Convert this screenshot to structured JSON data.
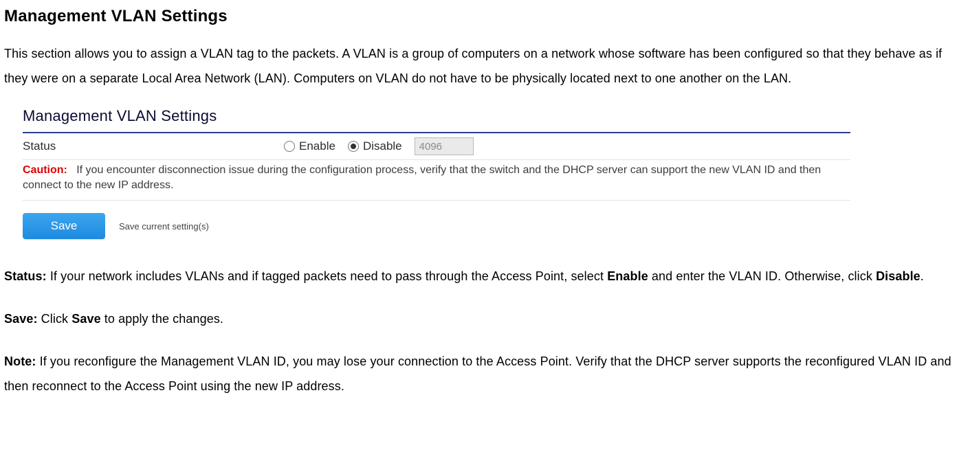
{
  "heading": "Management VLAN Settings",
  "intro": "This section allows you to assign a VLAN tag to the packets. A VLAN is a group of computers on a network whose software has been configured so that they behave as if they were on a separate Local Area Network (LAN). Computers on VLAN do not have to be physically located next to one another on the LAN.",
  "panel": {
    "title": "Management VLAN Settings",
    "row_label": "Status",
    "enable_label": "Enable",
    "disable_label": "Disable",
    "vlan_value": "4096",
    "caution_word": "Caution:",
    "caution_text": "If you encounter disconnection issue during the configuration process, verify that the switch and the DHCP server can support the new VLAN ID and then connect to the new IP address.",
    "save_button": "Save",
    "save_hint": "Save current setting(s)"
  },
  "status": {
    "label": "Status:",
    "text_a": " If your network includes VLANs and if tagged packets need to pass through the Access Point, select ",
    "enable": "Enable",
    "text_b": " and enter the VLAN ID. Otherwise, click ",
    "disable": "Disable",
    "period": "."
  },
  "save": {
    "label": "Save:",
    "text_a": " Click ",
    "save_word": "Save",
    "text_b": " to apply the changes."
  },
  "note": {
    "label": "Note:",
    "text": " If you reconfigure the Management VLAN ID, you may lose your connection to the Access Point. Verify that the DHCP server supports the reconfigured VLAN ID and then reconnect to the Access Point using the new IP address."
  }
}
